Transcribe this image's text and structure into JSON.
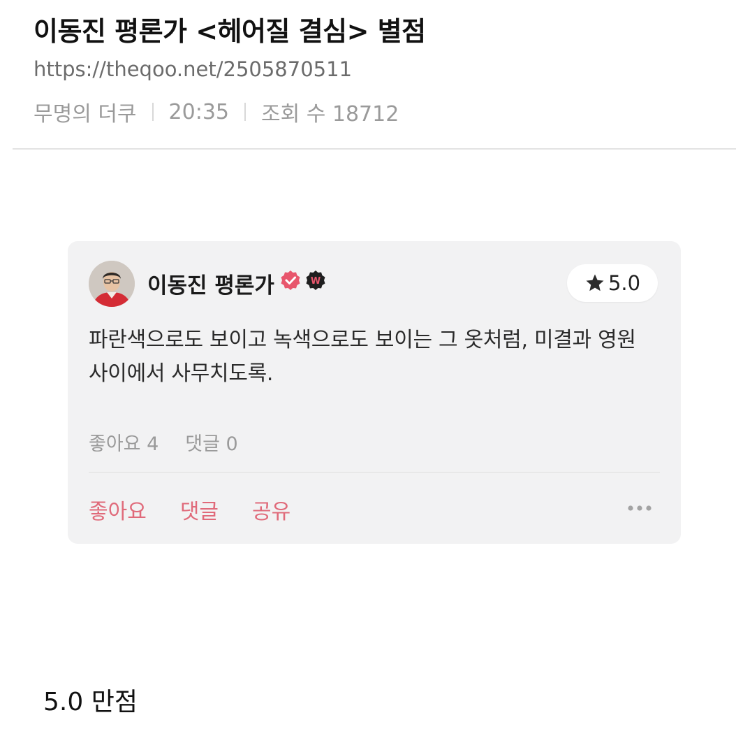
{
  "post": {
    "title": "이동진 평론가 <헤어질 결심> 별점",
    "url": "https://theqoo.net/2505870511",
    "author": "무명의 더쿠",
    "time": "20:35",
    "views": "조회 수 18712"
  },
  "review_card": {
    "critic_name": "이동진 평론가",
    "avatar_icon": "critic-avatar",
    "verified_icon": "verified-check-icon",
    "badge_icon": "w-badge-icon",
    "badge_letter": "W",
    "rating": "5.0",
    "rating_icon": "star-icon",
    "review_text": "파란색으로도 보이고 녹색으로도 보이는 그 옷처럼, 미결과 영원 사이에서 사무치도록.",
    "likes_count": "좋아요 4",
    "comments_count": "댓글 0",
    "actions": {
      "like": "좋아요",
      "comment": "댓글",
      "share": "공유"
    },
    "more_icon": "more-dots-icon"
  },
  "caption": "5.0 만점",
  "colors": {
    "accent": "#e06a7a",
    "verified": "#e8566c",
    "card_bg": "#f2f2f3",
    "meta_text": "#9a9a9a"
  }
}
